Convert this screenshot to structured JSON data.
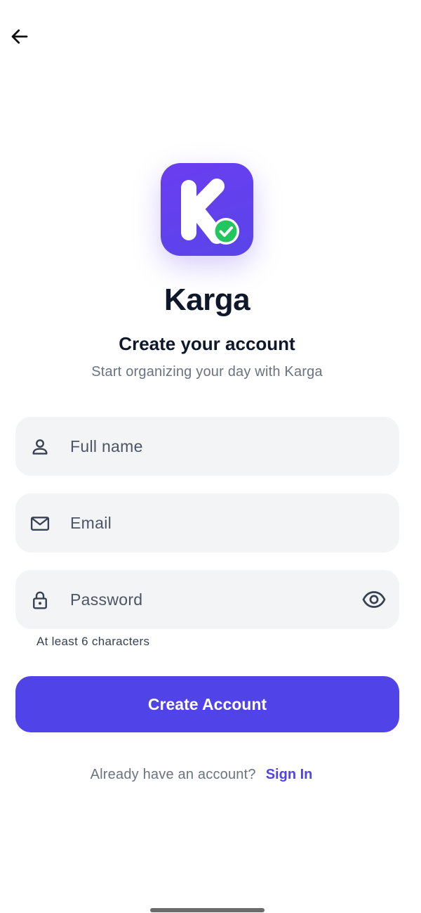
{
  "app": {
    "name": "Karga",
    "heading": "Create your account",
    "subheading": "Start organizing your day with Karga"
  },
  "logo": {
    "letter": "K",
    "badge_icon": "check-circle-icon"
  },
  "form": {
    "full_name": {
      "placeholder": "Full name",
      "value": "",
      "icon": "person-icon"
    },
    "email": {
      "placeholder": "Email",
      "value": "",
      "icon": "mail-icon"
    },
    "password": {
      "placeholder": "Password",
      "value": "",
      "icon": "lock-icon",
      "toggle_icon": "eye-icon",
      "helper": "At least 6 characters"
    }
  },
  "actions": {
    "create_account_label": "Create Account",
    "signin_prompt": "Already have an account?",
    "signin_link": "Sign In"
  },
  "nav": {
    "back_icon": "arrow-left-icon"
  },
  "colors": {
    "accent": "#5043e8",
    "logo_bg": "#6a3df0",
    "badge": "#22c55e",
    "field_bg": "#f3f4f6",
    "title": "#0f172a",
    "muted": "#6b7280"
  }
}
